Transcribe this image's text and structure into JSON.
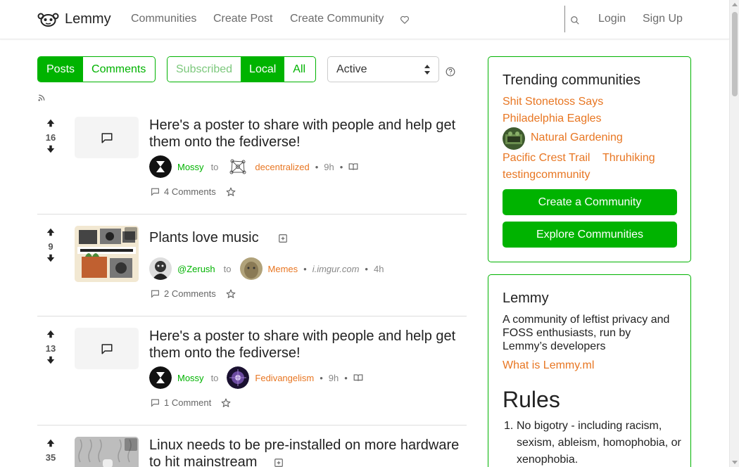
{
  "navbar": {
    "brand": "Lemmy",
    "links": [
      "Communities",
      "Create Post",
      "Create Community"
    ],
    "login": "Login",
    "signup": "Sign Up"
  },
  "filters": {
    "type_tabs": [
      "Posts",
      "Comments"
    ],
    "listing_tabs": [
      "Subscribed",
      "Local",
      "All"
    ],
    "sort_value": "Active"
  },
  "posts": [
    {
      "score": "16",
      "title": "Here's a poster to share with people and help get them onto the fediverse!",
      "user": "Mossy",
      "to": "to",
      "community": "decentralized",
      "time": "9h",
      "comments": "4 Comments"
    },
    {
      "score": "9",
      "title": "Plants love music",
      "user": "@Zerush",
      "to": "to",
      "community": "Memes",
      "domain": "i.imgur.com",
      "time": "4h",
      "comments": "2 Comments"
    },
    {
      "score": "13",
      "title": "Here's a poster to share with people and help get them onto the fediverse!",
      "user": "Mossy",
      "to": "to",
      "community": "Fedivangelism",
      "time": "9h",
      "comments": "1 Comment"
    },
    {
      "score": "35",
      "title": "Linux needs to be pre-installed on more hardware to hit mainstream"
    }
  ],
  "trending": {
    "title": "Trending communities",
    "communities": [
      "Shit Stonetoss Says",
      "Philadelphia Eagles",
      "Natural Gardening",
      "Pacific Crest Trail",
      "Thruhiking",
      "testingcommunity"
    ],
    "create_button": "Create a Community",
    "explore_button": "Explore Communities"
  },
  "site": {
    "name": "Lemmy",
    "description": "A community of leftist privacy and FOSS enthusiasts, run by Lemmy’s developers",
    "link": "What is Lemmy.ml",
    "rules_title": "Rules",
    "rules_number": "1.",
    "rules_first": "No bigotry - including racism, sexism, ableism, homophobia, or xenophobia."
  },
  "colors": {
    "accent": "#00b300",
    "community": "#e87622"
  }
}
